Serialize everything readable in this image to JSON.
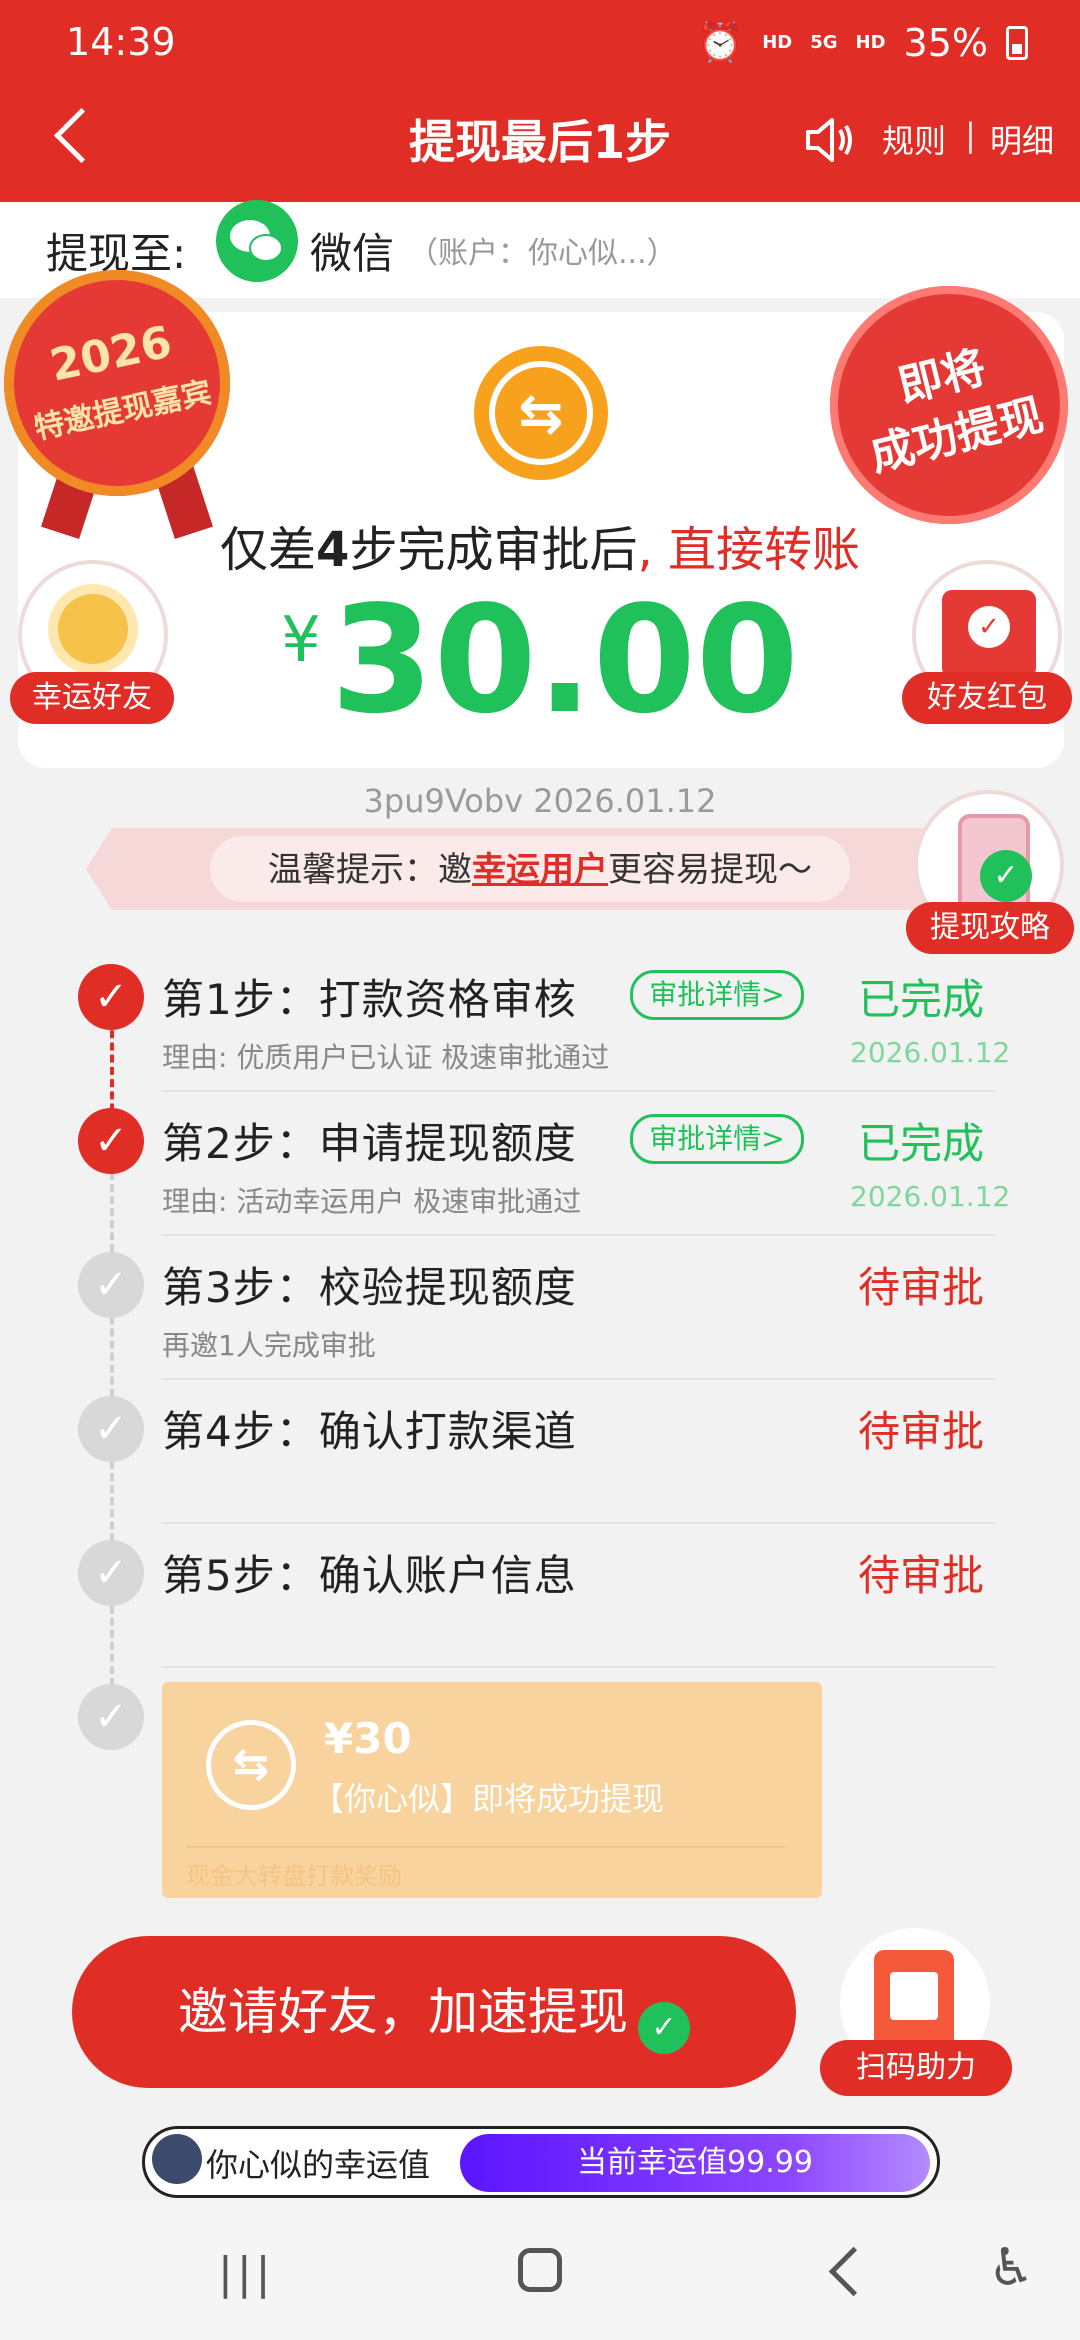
{
  "status_bar": {
    "time": "14:39",
    "battery": "35%",
    "hd1": "HD",
    "hd2": "HD",
    "net": "5G"
  },
  "header": {
    "title": "提现最后1步",
    "rules": "规则",
    "separator": "|",
    "details": "明细"
  },
  "withdraw_to": {
    "label": "提现至:",
    "wechat": "微信",
    "account": "（账户：你心似...）"
  },
  "card": {
    "headline_prefix": "仅差",
    "headline_num": "4",
    "headline_mid": "步完成审批后",
    "headline_comma": ",",
    "headline_red": " 直接转账",
    "currency": "¥",
    "amount": "30.00"
  },
  "badges": {
    "seal_left_year": "2026",
    "seal_left_text": "特邀提现嘉宾",
    "seal_right_line1": "即将",
    "seal_right_line2": "成功提现",
    "lucky_friend": "幸运好友",
    "friend_redpacket": "好友红包",
    "strategy": "提现攻略"
  },
  "code_line": "3pu9Vobv 2026.01.12",
  "tip": {
    "prefix": "温馨提示：邀",
    "emphasis": "幸运用户",
    "suffix": "更容易提现～"
  },
  "steps": [
    {
      "title": "第1步：打款资格审核",
      "reason": "理由: 优质用户已认证 极速审批通过",
      "detail_btn": "审批详情>",
      "status": "已完成",
      "date": "2026.01.12"
    },
    {
      "title": "第2步：申请提现额度",
      "reason": "理由: 活动幸运用户 极速审批通过",
      "detail_btn": "审批详情>",
      "status": "已完成",
      "date": "2026.01.12"
    },
    {
      "title": "第3步：校验提现额度",
      "reason": "再邀1人完成审批",
      "status": "待审批"
    },
    {
      "title": "第4步：确认打款渠道",
      "status": "待审批"
    },
    {
      "title": "第5步：确认账户信息",
      "status": "待审批"
    }
  ],
  "final_card": {
    "amount": "¥30",
    "text": "【你心似】即将成功提现",
    "small": "现金大转盘打款奖励"
  },
  "invite_button": "邀请好友，加速提现",
  "scan_label": "扫码助力",
  "luck": {
    "label": "你心似的幸运值",
    "bar": "当前幸运值99.99"
  },
  "icons": {
    "check": "✓",
    "exchange": "⇆",
    "accessibility": "♿"
  },
  "colors": {
    "primary_red": "#e02d26",
    "wechat_green": "#20c05a",
    "accent_orange": "#f7a11c",
    "luck_purple": "#5b15ff"
  }
}
